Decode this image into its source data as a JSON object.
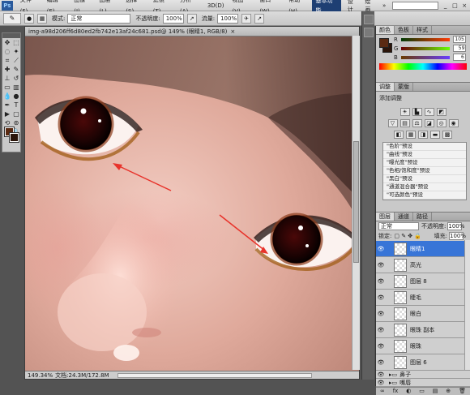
{
  "menubar": {
    "logo": "Ps",
    "items": [
      "文件(F)",
      "编辑(E)",
      "图像(I)",
      "图层(L)",
      "选择(S)",
      "滤镜(T)",
      "分析(A)",
      "3D(D)",
      "视图(V)",
      "窗口(W)",
      "帮助(H)"
    ],
    "workspace_active": "基本功能",
    "workspace_items": [
      "设计",
      "绘画",
      "»"
    ],
    "window_controls": [
      "_",
      "□",
      "×"
    ]
  },
  "options_bar": {
    "tool_preset": "✎",
    "mode_label": "模式:",
    "mode_value": "正常",
    "opacity_label": "不透明度:",
    "opacity_value": "100%",
    "flow_label": "流量:",
    "flow_value": "100%"
  },
  "document": {
    "tab_title": "img-a98d206ff6d80ed2fb742e13af24c681.psd@ 149% (眼睛1, RGB/8)",
    "tab_close": "×",
    "zoom": "149.34%",
    "doc_size": "文档:24.3M/172.8M"
  },
  "colors": {
    "foreground": "#5a2a12",
    "background": "#2b150a",
    "arrow": "#e8332b",
    "selection": "#3875d7"
  },
  "color_panel": {
    "tabs": [
      "颜色",
      "色板",
      "样式"
    ],
    "channels": [
      {
        "label": "R",
        "value": "105"
      },
      {
        "label": "G",
        "value": "59"
      },
      {
        "label": "B",
        "value": "6"
      }
    ]
  },
  "adjustments_panel": {
    "tabs": [
      "调整",
      "蒙版"
    ],
    "title": "添加调整",
    "presets": [
      "\"色阶\"预设",
      "\"曲线\"预设",
      "\"曝光度\"预设",
      "\"色相/饱和度\"预设",
      "\"黑白\"预设",
      "\"通道混合器\"预设",
      "\"可选颜色\"预设"
    ]
  },
  "layers_panel": {
    "tabs": [
      "图层",
      "通道",
      "路径"
    ],
    "blend_mode": "正常",
    "opacity_label": "不透明度:",
    "opacity_value": "100%",
    "lock_label": "锁定:",
    "fill_label": "填充:",
    "fill_value": "100%",
    "layers": [
      {
        "name": "眼睛1",
        "selected": true
      },
      {
        "name": "高光",
        "selected": false
      },
      {
        "name": "图层 8",
        "selected": false
      },
      {
        "name": "睫毛",
        "selected": false
      },
      {
        "name": "眼白",
        "selected": false
      },
      {
        "name": "眼珠 副本",
        "selected": false
      },
      {
        "name": "眼珠",
        "selected": false
      },
      {
        "name": "图层 6",
        "selected": false
      }
    ],
    "groups": [
      {
        "name": "鼻子"
      },
      {
        "name": "嘴唇"
      }
    ],
    "footer": [
      "∞",
      "fx",
      "◐",
      "▭",
      "▤",
      "⊕",
      "🗑"
    ]
  }
}
